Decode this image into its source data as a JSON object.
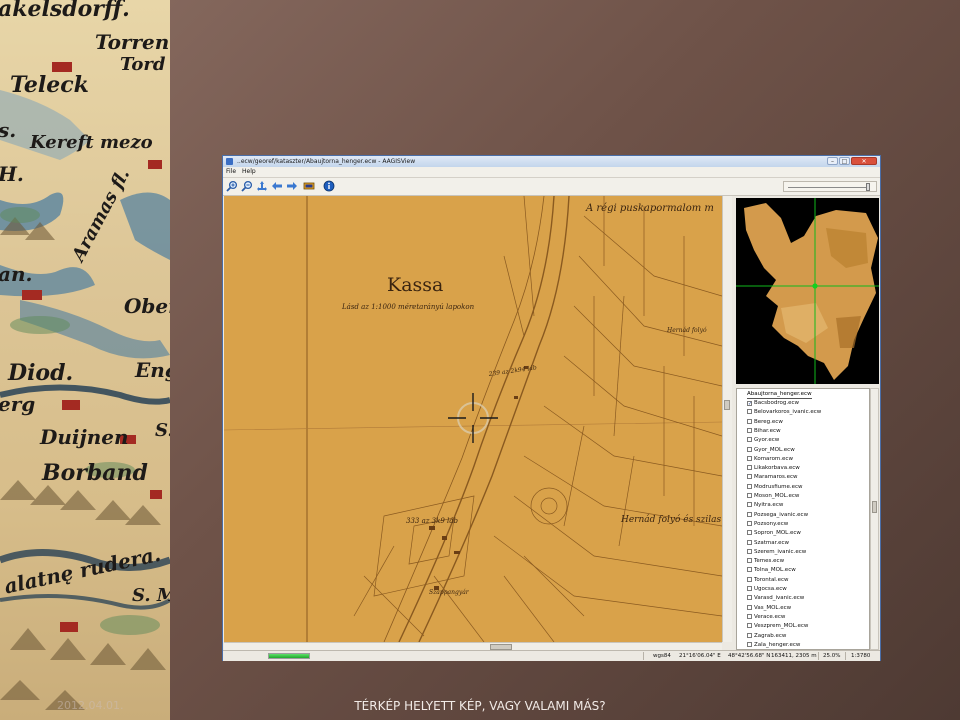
{
  "window": {
    "title": "..ecw/georef/kataszter/Abaujtorna_henger.ecw - AAGISView"
  },
  "menu": [
    "File",
    "Help"
  ],
  "toolbar": {
    "tools": [
      "zoom-in-icon",
      "zoom-out-icon",
      "pan-icon",
      "zoom-back-icon",
      "zoom-forward-icon",
      "layers-icon",
      "info-icon"
    ],
    "opacity_level": 0.95
  },
  "map": {
    "labels": {
      "city": "Kassa",
      "subtitle": "Lásd az 1:1000 méretarányú lapokon",
      "top": "A régi puskapormalom m",
      "river1": "Hernád folyó",
      "river2": "Hernád folyó és szilas",
      "elev1": "239 az 2k94 láb",
      "elev2": "333 az 3k9 láb",
      "place": "Szappangyár"
    }
  },
  "layers": {
    "header": "Abaujtorna_henger.ecw",
    "items": [
      {
        "label": "Bacsbodrog.ecw",
        "checked": true
      },
      {
        "label": "Belovarkoros_ivanic.ecw",
        "checked": false
      },
      {
        "label": "Bereg.ecw",
        "checked": false
      },
      {
        "label": "Bihar.ecw",
        "checked": false
      },
      {
        "label": "Gyor.ecw",
        "checked": false
      },
      {
        "label": "Gyor_MOL.ecw",
        "checked": false
      },
      {
        "label": "Komarom.ecw",
        "checked": false
      },
      {
        "label": "Likakorbava.ecw",
        "checked": false
      },
      {
        "label": "Maramaros.ecw",
        "checked": false
      },
      {
        "label": "Modrusfiume.ecw",
        "checked": false
      },
      {
        "label": "Moson_MOL.ecw",
        "checked": false
      },
      {
        "label": "Nyitra.ecw",
        "checked": false
      },
      {
        "label": "Pozsega_ivanic.ecw",
        "checked": false
      },
      {
        "label": "Pozsony.ecw",
        "checked": false
      },
      {
        "label": "Sopron_MOL.ecw",
        "checked": false
      },
      {
        "label": "Szatmar.ecw",
        "checked": false
      },
      {
        "label": "Szerem_ivanic.ecw",
        "checked": false
      },
      {
        "label": "Temes.ecw",
        "checked": false
      },
      {
        "label": "Tolna_MOL.ecw",
        "checked": false
      },
      {
        "label": "Torontal.ecw",
        "checked": false
      },
      {
        "label": "Ugocsa.ecw",
        "checked": false
      },
      {
        "label": "Varasd_ivanic.ecw",
        "checked": false
      },
      {
        "label": "Vas_MOL.ecw",
        "checked": false
      },
      {
        "label": "Verace.ecw",
        "checked": false
      },
      {
        "label": "Veszprem_MOL.ecw",
        "checked": false
      },
      {
        "label": "Zagrab.ecw",
        "checked": false
      },
      {
        "label": "Zala_henger.ecw",
        "checked": false
      }
    ]
  },
  "status": {
    "progress": 1.0,
    "projection": "wgs84",
    "lon": "21°16'06.04\" E",
    "lat": "48°42'56.68\" N",
    "xy": "163411, 2305 m",
    "zoom": "25.0%",
    "scale": "1:3780"
  },
  "oldmap": {
    "words": [
      "akelsdorff.",
      "Torren",
      "Tord",
      "Teleck",
      "s.",
      "Kereft mezo",
      "H.",
      "Aramas fl.",
      "an.",
      "Ober",
      "Diod.",
      "Eng",
      "erg",
      "Duijnen",
      "Borband",
      "S.",
      "alatnę rudera.",
      "S. M"
    ]
  },
  "footer": {
    "caption": "TÉRKÉP HELYETT KÉP, VAGY VALAMI MÁS?",
    "date": "2012.04.01."
  }
}
